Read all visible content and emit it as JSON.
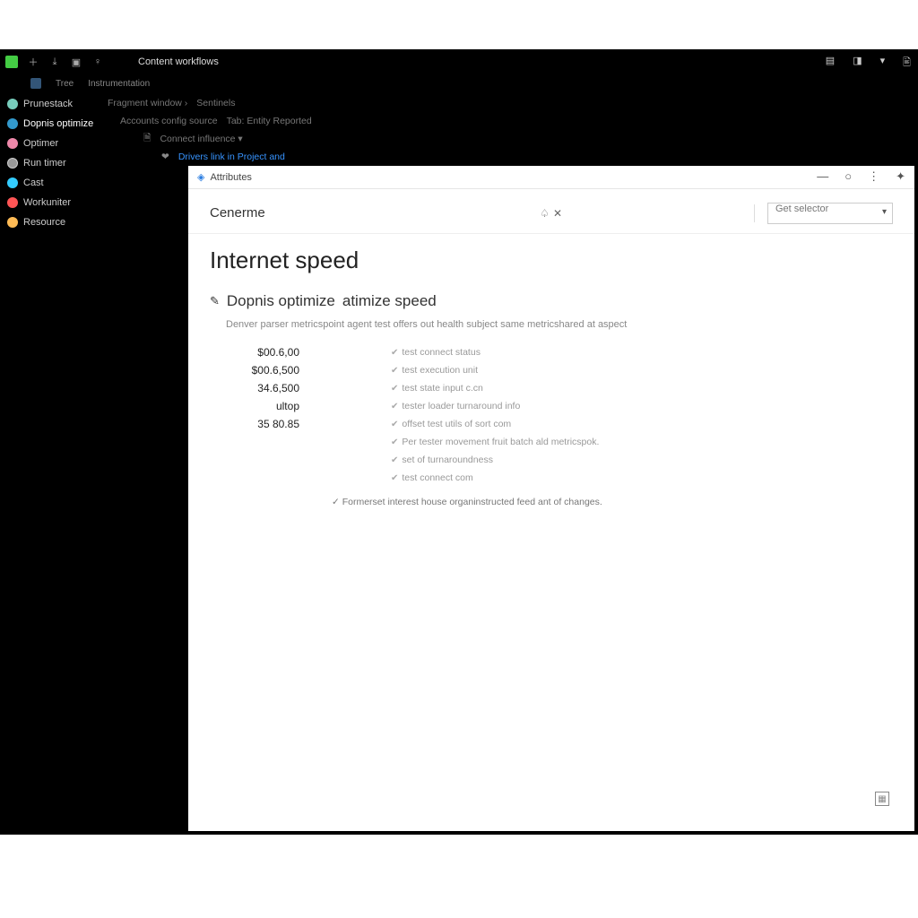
{
  "topbar": {
    "title": "Content workflows",
    "tabs": [
      "Tree",
      "Instrumentation"
    ],
    "right_icons": [
      "panel-icon",
      "layout-icon",
      "more-icon",
      "save-icon"
    ]
  },
  "sidebar": {
    "items": [
      {
        "label": "Prunestack",
        "icon": "box-icon",
        "color": "#b0e0ff"
      },
      {
        "label": "Dopnis optimize",
        "icon": "gear-icon",
        "color": "#39c"
      },
      {
        "label": "Optimer",
        "icon": "wrench-icon",
        "color": "#e8a"
      },
      {
        "label": "Run timer",
        "icon": "clock-icon",
        "color": "#ccc"
      },
      {
        "label": "Cast",
        "icon": "globe-icon",
        "color": "#3cf"
      },
      {
        "label": "Workuniter",
        "icon": "users-icon",
        "color": "#f55"
      },
      {
        "label": "Resource",
        "icon": "folder-icon",
        "color": "#fb5"
      }
    ]
  },
  "tree": {
    "rows": [
      {
        "segments": [
          "Fragment window ›",
          "Sentinels"
        ],
        "chev": true
      },
      {
        "segments": [
          "Accounts config source",
          "Tab: Entity Reported"
        ],
        "indent": 10
      },
      {
        "segments": [
          "Connect influence ▾"
        ],
        "icon": "page-icon",
        "indent": 22
      },
      {
        "segments": [
          "Drivers link in Project and"
        ],
        "link": true,
        "icon": "chev-icon",
        "indent": 34
      }
    ]
  },
  "inner_window": {
    "titlebar": {
      "crumb": "Attributes",
      "buttons": [
        "minimize",
        "maximize",
        "more",
        "help"
      ]
    },
    "header": {
      "name": "Cenerme",
      "dropdown": "Get selector"
    },
    "page": {
      "title": "Internet speed",
      "subtitle_prefix": "Dopnis optimize",
      "subtitle_suffix": "atimize speed",
      "description": "Denver parser metricspoint agent test offers out health subject same metricshared at aspect",
      "metrics": [
        {
          "value": "$00.6,00",
          "label": "test connect status"
        },
        {
          "value": "$00.6,500",
          "label": "test execution unit"
        },
        {
          "value": "34.6,500",
          "label": "test state input c.cn"
        },
        {
          "value": "ultop",
          "label": "tester loader turnaround info"
        },
        {
          "value": "35 80.85",
          "label": "offset test utils of sort com"
        },
        {
          "value": "",
          "label": "Per tester movement fruit batch ald metricspok."
        },
        {
          "value": "",
          "label": "set of turnaroundness"
        },
        {
          "value": "",
          "label": "test connect com"
        }
      ],
      "summary": "✓ Formerset interest house organinstructed feed ant of changes."
    }
  }
}
